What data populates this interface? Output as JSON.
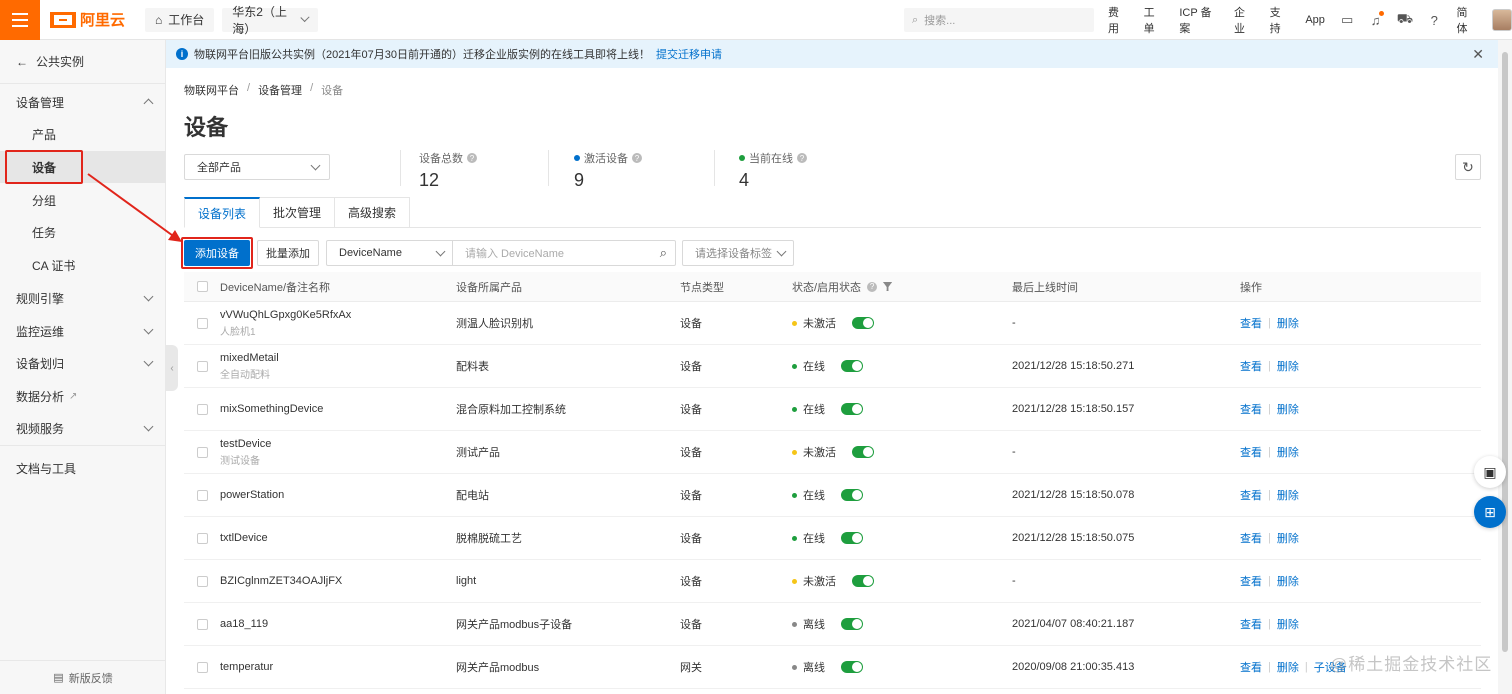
{
  "topbar": {
    "brand": "阿里云",
    "workbench": "工作台",
    "region": "华东2（上海）",
    "search_placeholder": "搜索...",
    "links": [
      "费用",
      "工单",
      "ICP 备案",
      "企业",
      "支持",
      "App"
    ],
    "lang": "简体"
  },
  "sidebar": {
    "back_label": "公共实例",
    "groups": [
      {
        "label": "设备管理",
        "expanded": true
      },
      {
        "label": "规则引擎"
      },
      {
        "label": "监控运维"
      },
      {
        "label": "设备划归"
      },
      {
        "label": "数据分析"
      },
      {
        "label": "视频服务"
      },
      {
        "label": "文档与工具"
      }
    ],
    "items": [
      "产品",
      "设备",
      "分组",
      "任务",
      "CA 证书"
    ],
    "active_item": "设备",
    "feedback": "新版反馈"
  },
  "notice": {
    "text": "物联网平台旧版公共实例（2021年07月30日前开通的）迁移企业版实例的在线工具即将上线！",
    "link": "提交迁移申请"
  },
  "breadcrumb": [
    "物联网平台",
    "设备管理",
    "设备"
  ],
  "page_title": "设备",
  "product_select": "全部产品",
  "stats": [
    {
      "label": "设备总数",
      "value": "12"
    },
    {
      "label": "激活设备",
      "value": "9",
      "color": "#0070cc"
    },
    {
      "label": "当前在线",
      "value": "4",
      "color": "#1e9e3e"
    }
  ],
  "tabs": [
    "设备列表",
    "批次管理",
    "高级搜索"
  ],
  "toolbar": {
    "add_device": "添加设备",
    "batch_add": "批量添加",
    "search_field": "DeviceName",
    "search_placeholder": "请输入 DeviceName",
    "tag_placeholder": "请选择设备标签"
  },
  "table": {
    "headers": [
      "DeviceName/备注名称",
      "设备所属产品",
      "节点类型",
      "状态/启用状态",
      "最后上线时间",
      "操作"
    ],
    "rows": [
      {
        "name": "vVWuQhLGpxg0Ke5RfxAx",
        "note": "人脸机1",
        "product": "测温人脸识别机",
        "node": "设备",
        "status": "未激活",
        "last": "-",
        "extra": ""
      },
      {
        "name": "mixedMetail",
        "note": "全自动配料",
        "product": "配料表",
        "node": "设备",
        "status": "在线",
        "last": "2021/12/28 15:18:50.271",
        "extra": ""
      },
      {
        "name": "mixSomethingDevice",
        "note": "",
        "product": "混合原料加工控制系统",
        "node": "设备",
        "status": "在线",
        "last": "2021/12/28 15:18:50.157",
        "extra": ""
      },
      {
        "name": "testDevice",
        "note": "测试设备",
        "product": "测试产品",
        "node": "设备",
        "status": "未激活",
        "last": "-",
        "extra": ""
      },
      {
        "name": "powerStation",
        "note": "",
        "product": "配电站",
        "node": "设备",
        "status": "在线",
        "last": "2021/12/28 15:18:50.078",
        "extra": ""
      },
      {
        "name": "txtlDevice",
        "note": "",
        "product": "脱棉脱硫工艺",
        "node": "设备",
        "status": "在线",
        "last": "2021/12/28 15:18:50.075",
        "extra": ""
      },
      {
        "name": "BZICglnmZET34OAJljFX",
        "note": "",
        "product": "light",
        "node": "设备",
        "status": "未激活",
        "last": "-",
        "extra": ""
      },
      {
        "name": "aa18_119",
        "note": "",
        "product": "网关产品modbus子设备",
        "node": "设备",
        "status": "离线",
        "last": "2021/04/07 08:40:21.187",
        "extra": ""
      },
      {
        "name": "temperatur",
        "note": "",
        "product": "网关产品modbus",
        "node": "网关",
        "status": "离线",
        "last": "2020/09/08 21:00:35.413",
        "extra": "子设备"
      }
    ],
    "actions": {
      "view": "查看",
      "delete": "删除"
    },
    "status_colors": {
      "未激活": "#f5c518",
      "在线": "#1e9e3e",
      "离线": "#888888"
    }
  },
  "watermark": "@稀土掘金技术社区"
}
